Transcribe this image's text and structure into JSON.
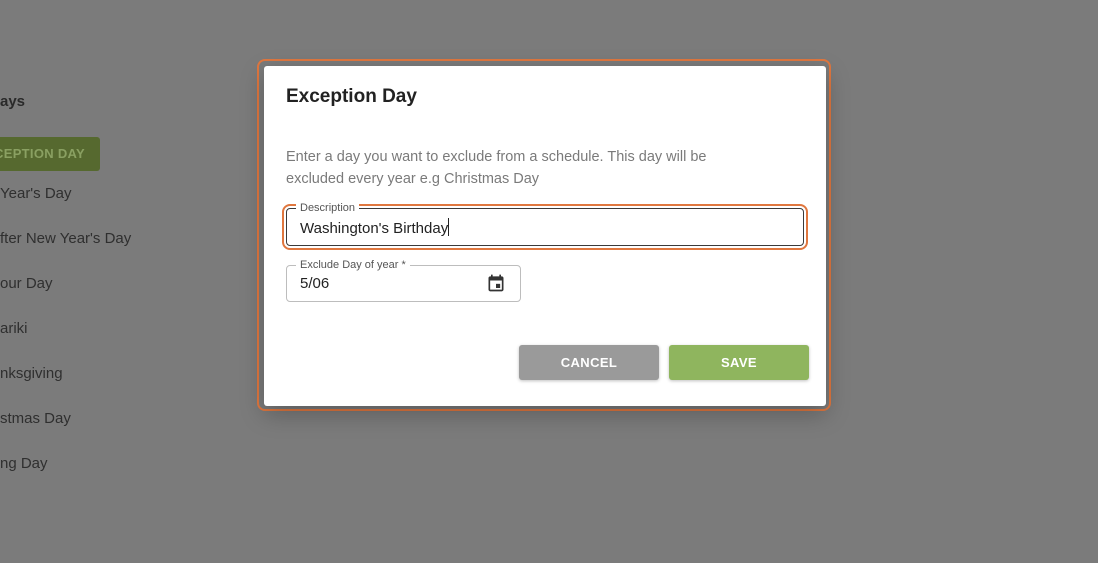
{
  "background": {
    "section_title": "ays",
    "add_button_label": "CEPTION DAY",
    "items": [
      "Year's Day",
      "fter New Year's Day",
      "our Day",
      "ariki",
      "nksgiving",
      "stmas Day",
      "ng Day"
    ]
  },
  "dialog": {
    "title": "Exception Day",
    "description": "Enter a day you want to exclude from a schedule. This day will be excluded every year e.g Christmas Day",
    "description_field": {
      "label": "Description",
      "value": "Washington's Birthday"
    },
    "date_field": {
      "label": "Exclude Day of year *",
      "value": "5/06",
      "icon": "calendar-icon"
    },
    "cancel_label": "CANCEL",
    "save_label": "SAVE"
  },
  "colors": {
    "focus_ring": "#e0773f",
    "save_button": "#8fb55e",
    "cancel_button": "#9a9a9a"
  }
}
